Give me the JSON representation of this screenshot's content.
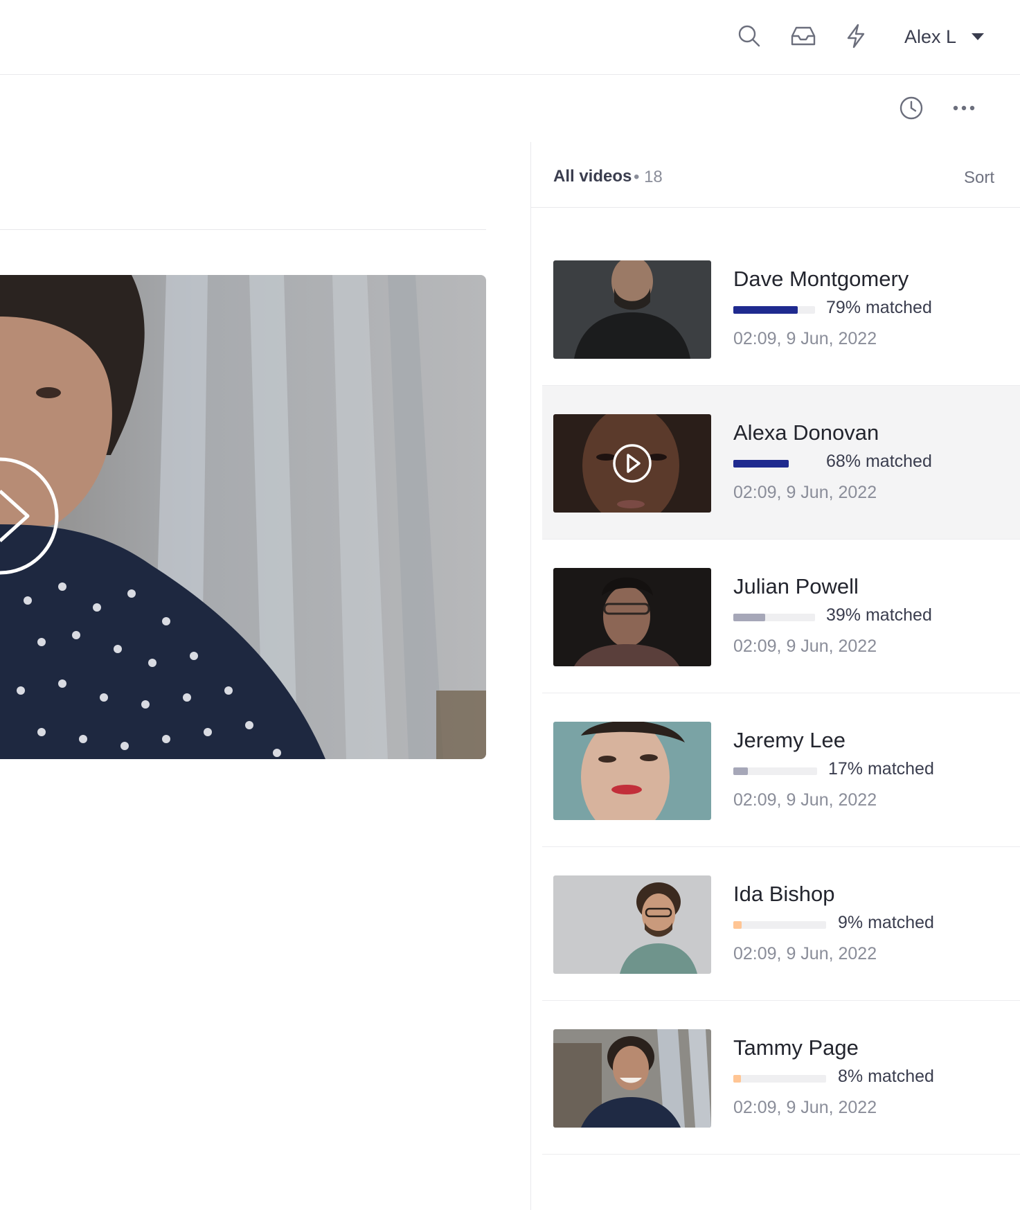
{
  "header": {
    "user_name": "Alex L",
    "icons": [
      "search-icon",
      "inbox-icon",
      "bolt-icon",
      "chevron-down-icon"
    ]
  },
  "toolbar": {
    "icons": [
      "clock-icon",
      "more-icon"
    ]
  },
  "panel": {
    "title": "All videos",
    "count": "• 18",
    "sort_label": "Sort"
  },
  "colors": {
    "high_match": "#1f2a8f",
    "mid_match": "#a6a7b8",
    "low_match": "#ffc594",
    "active_row": "#f4f4f5"
  },
  "videos": [
    {
      "name": "Dave Montgomery",
      "match_label": "79% matched",
      "match": 0.79,
      "bar_color": "#1f2a8f",
      "date": "02:09, 9 Jun, 2022"
    },
    {
      "name": "Alexa Donovan",
      "match_label": "68% matched",
      "match": 0.68,
      "bar_color": "#1f2a8f",
      "date": "02:09, 9 Jun, 2022"
    },
    {
      "name": "Julian Powell",
      "match_label": "39% matched",
      "match": 0.39,
      "bar_color": "#a6a7b8",
      "date": "02:09, 9 Jun, 2022"
    },
    {
      "name": "Jeremy Lee",
      "match_label": "17% matched",
      "match": 0.17,
      "bar_color": "#a6a7b8",
      "date": "02:09, 9 Jun, 2022"
    },
    {
      "name": "Ida Bishop",
      "match_label": "9% matched",
      "match": 0.09,
      "bar_color": "#ffc594",
      "date": "02:09, 9 Jun, 2022"
    },
    {
      "name": "Tammy Page",
      "match_label": "8% matched",
      "match": 0.08,
      "bar_color": "#ffc594",
      "date": "02:09, 9 Jun, 2022"
    }
  ]
}
